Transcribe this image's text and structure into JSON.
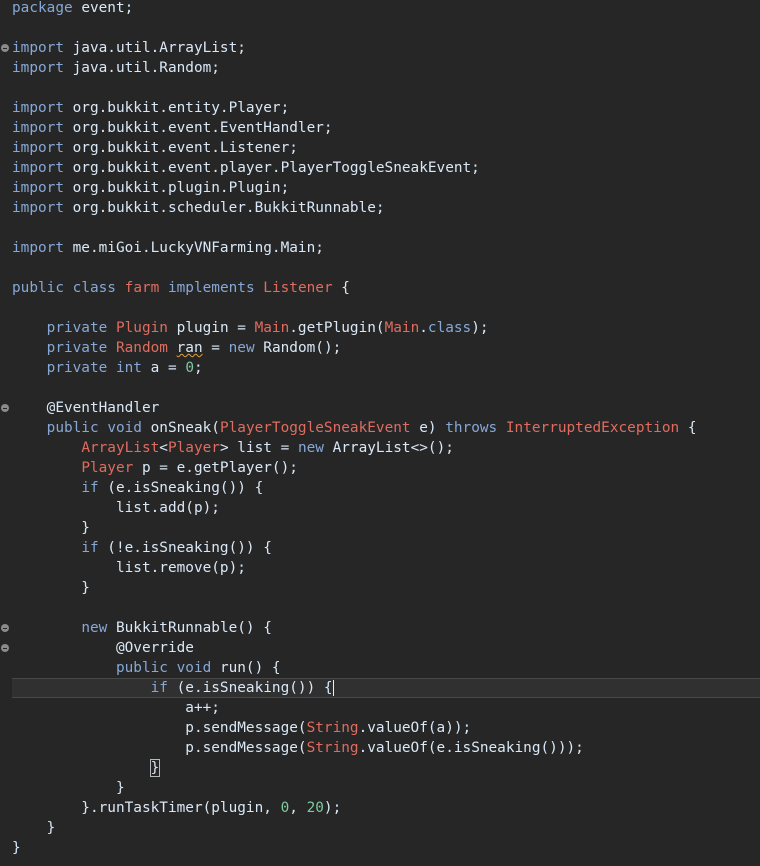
{
  "editor": {
    "code_lines": [
      "package event;",
      "",
      "import java.util.ArrayList;",
      "import java.util.Random;",
      "",
      "import org.bukkit.entity.Player;",
      "import org.bukkit.event.EventHandler;",
      "import org.bukkit.event.Listener;",
      "import org.bukkit.event.player.PlayerToggleSneakEvent;",
      "import org.bukkit.plugin.Plugin;",
      "import org.bukkit.scheduler.BukkitRunnable;",
      "",
      "import me.miGoi.LuckyVNFarming.Main;",
      "",
      "public class farm implements Listener {",
      "",
      "    private Plugin plugin = Main.getPlugin(Main.class);",
      "    private Random ran = new Random();",
      "    private int a = 0;",
      "",
      "    @EventHandler",
      "    public void onSneak(PlayerToggleSneakEvent e) throws InterruptedException {",
      "        ArrayList<Player> list = new ArrayList<>();",
      "        Player p = e.getPlayer();",
      "        if (e.isSneaking()) {",
      "            list.add(p);",
      "        }",
      "        if (!e.isSneaking()) {",
      "            list.remove(p);",
      "        }",
      "",
      "        new BukkitRunnable() {",
      "            @Override",
      "            public void run() {",
      "                if (e.isSneaking()) {",
      "                    a++;",
      "                    p.sendMessage(String.valueOf(a));",
      "                    p.sendMessage(String.valueOf(e.isSneaking()));",
      "                }",
      "            }",
      "        }.runTaskTimer(plugin, 0, 20);",
      "    }",
      "}"
    ],
    "fold_icon_name": "fold-collapse-icon",
    "current_line": 35,
    "colors": {
      "background": "#262626",
      "keyword": "#86a8d6",
      "type": "#e06c5f",
      "text": "#d9e8f7",
      "number": "#7fca9f",
      "current_line": "#303030"
    }
  }
}
